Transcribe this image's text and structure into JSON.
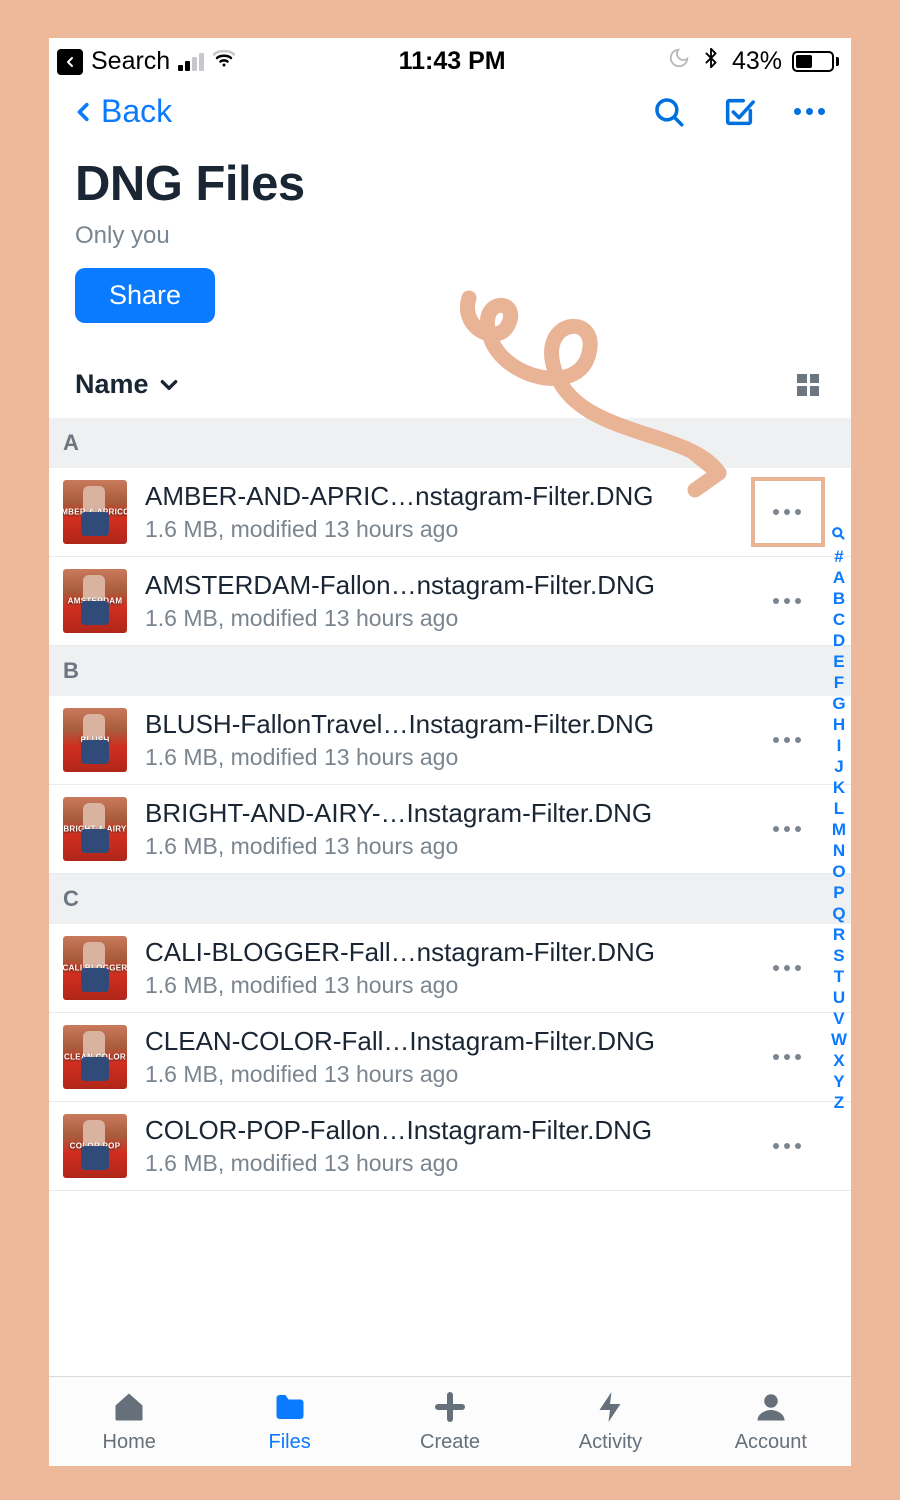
{
  "status": {
    "search_label": "Search",
    "time": "11:43 PM",
    "battery_pct": "43%"
  },
  "nav": {
    "back_label": "Back"
  },
  "header": {
    "title": "DNG Files",
    "subtitle": "Only you",
    "share_label": "Share"
  },
  "sort": {
    "label": "Name"
  },
  "sections": [
    {
      "letter": "A",
      "files": [
        {
          "name": "AMBER-AND-APRIC…nstagram-Filter.DNG",
          "meta": "1.6 MB, modified 13 hours ago",
          "thumb": "AMBER & APRICOT",
          "highlight": true
        },
        {
          "name": "AMSTERDAM-Fallon…nstagram-Filter.DNG",
          "meta": "1.6 MB, modified 13 hours ago",
          "thumb": "AMSTERDAM"
        }
      ]
    },
    {
      "letter": "B",
      "files": [
        {
          "name": "BLUSH-FallonTravel…Instagram-Filter.DNG",
          "meta": "1.6 MB, modified 13 hours ago",
          "thumb": "BLUSH"
        },
        {
          "name": "BRIGHT-AND-AIRY-…Instagram-Filter.DNG",
          "meta": "1.6 MB, modified 13 hours ago",
          "thumb": "BRIGHT & AIRY"
        }
      ]
    },
    {
      "letter": "C",
      "files": [
        {
          "name": "CALI-BLOGGER-Fall…nstagram-Filter.DNG",
          "meta": "1.6 MB, modified 13 hours ago",
          "thumb": "CALI BLOGGER"
        },
        {
          "name": "CLEAN-COLOR-Fall…Instagram-Filter.DNG",
          "meta": "1.6 MB, modified 13 hours ago",
          "thumb": "CLEAN COLOR"
        },
        {
          "name": "COLOR-POP-Fallon…Instagram-Filter.DNG",
          "meta": "1.6 MB, modified 13 hours ago",
          "thumb": "COLOR POP"
        }
      ]
    }
  ],
  "index_letters": [
    "#",
    "A",
    "B",
    "C",
    "D",
    "E",
    "F",
    "G",
    "H",
    "I",
    "J",
    "K",
    "L",
    "M",
    "N",
    "O",
    "P",
    "Q",
    "R",
    "S",
    "T",
    "U",
    "V",
    "W",
    "X",
    "Y",
    "Z"
  ],
  "tabs": [
    {
      "label": "Home",
      "active": false
    },
    {
      "label": "Files",
      "active": true
    },
    {
      "label": "Create",
      "active": false
    },
    {
      "label": "Activity",
      "active": false
    },
    {
      "label": "Account",
      "active": false
    }
  ]
}
